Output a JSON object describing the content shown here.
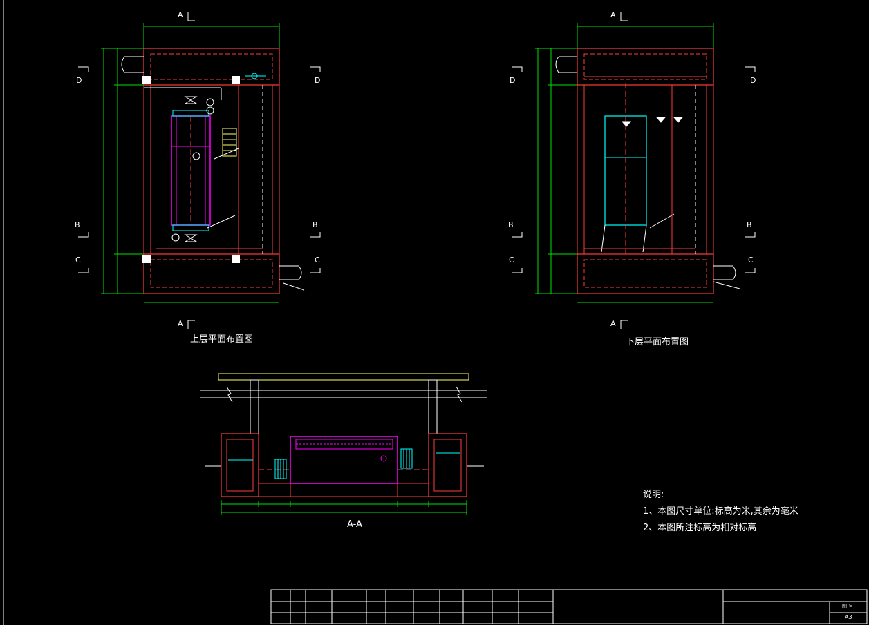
{
  "section_markers": {
    "A": "A",
    "B": "B",
    "C": "C",
    "D": "D"
  },
  "views": {
    "upper_plan_title": "上层平面布置图",
    "lower_plan_title": "下层平面布置图",
    "section_title": "A-A"
  },
  "notes": {
    "heading": "说明:",
    "items": [
      "1、本图尺寸单位:标高为米,其余为毫米",
      "2、本图所注标高为相对标高"
    ]
  },
  "title_block": {
    "sheet_size": "A3",
    "drawing_no_label": "图 号"
  },
  "colors": {
    "background": "#000000",
    "outline": "#ff3b3b",
    "dimension": "#00e000",
    "equipment": "#ff00ff",
    "water": "#00ffff",
    "white": "#ffffff",
    "frame": "#ffff66"
  }
}
